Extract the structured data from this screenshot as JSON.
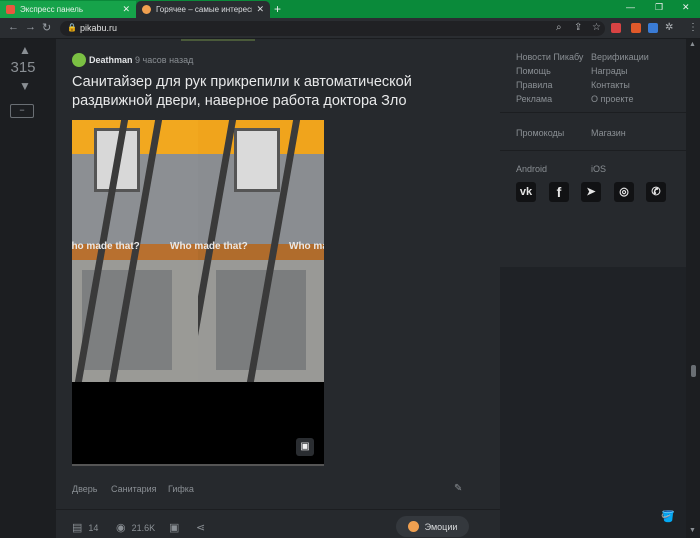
{
  "browser": {
    "tabs": [
      {
        "title": "Экспресс панель",
        "favicon_color": "#e9573f"
      },
      {
        "title": "Горячее – самые интересные и",
        "favicon_color": "#f0a050"
      }
    ],
    "url": "pikabu.ru"
  },
  "post": {
    "rating": "315",
    "author": "Deathman",
    "time": "9 часов назад",
    "title": "Санитайзер для рук прикрепили к автоматической раздвижной двери, наверное работа доктора Зло",
    "watermark": "Who made that?",
    "tags": [
      "Дверь",
      "Санитария",
      "Гифка"
    ],
    "comments": "14",
    "views": "21.6K",
    "emotions_label": "Эмоции"
  },
  "sidebar": {
    "links_col1": [
      "Новости Пикабу",
      "Помощь",
      "Правила",
      "Реклама"
    ],
    "links_col2": [
      "Верификации",
      "Награды",
      "Контакты",
      "О проекте"
    ],
    "promo": "Промокоды",
    "shop": "Магазин",
    "android": "Android",
    "ios": "iOS",
    "social_icons": [
      "vk-icon",
      "facebook-icon",
      "telegram-icon",
      "instagram-icon",
      "viber-icon"
    ]
  }
}
